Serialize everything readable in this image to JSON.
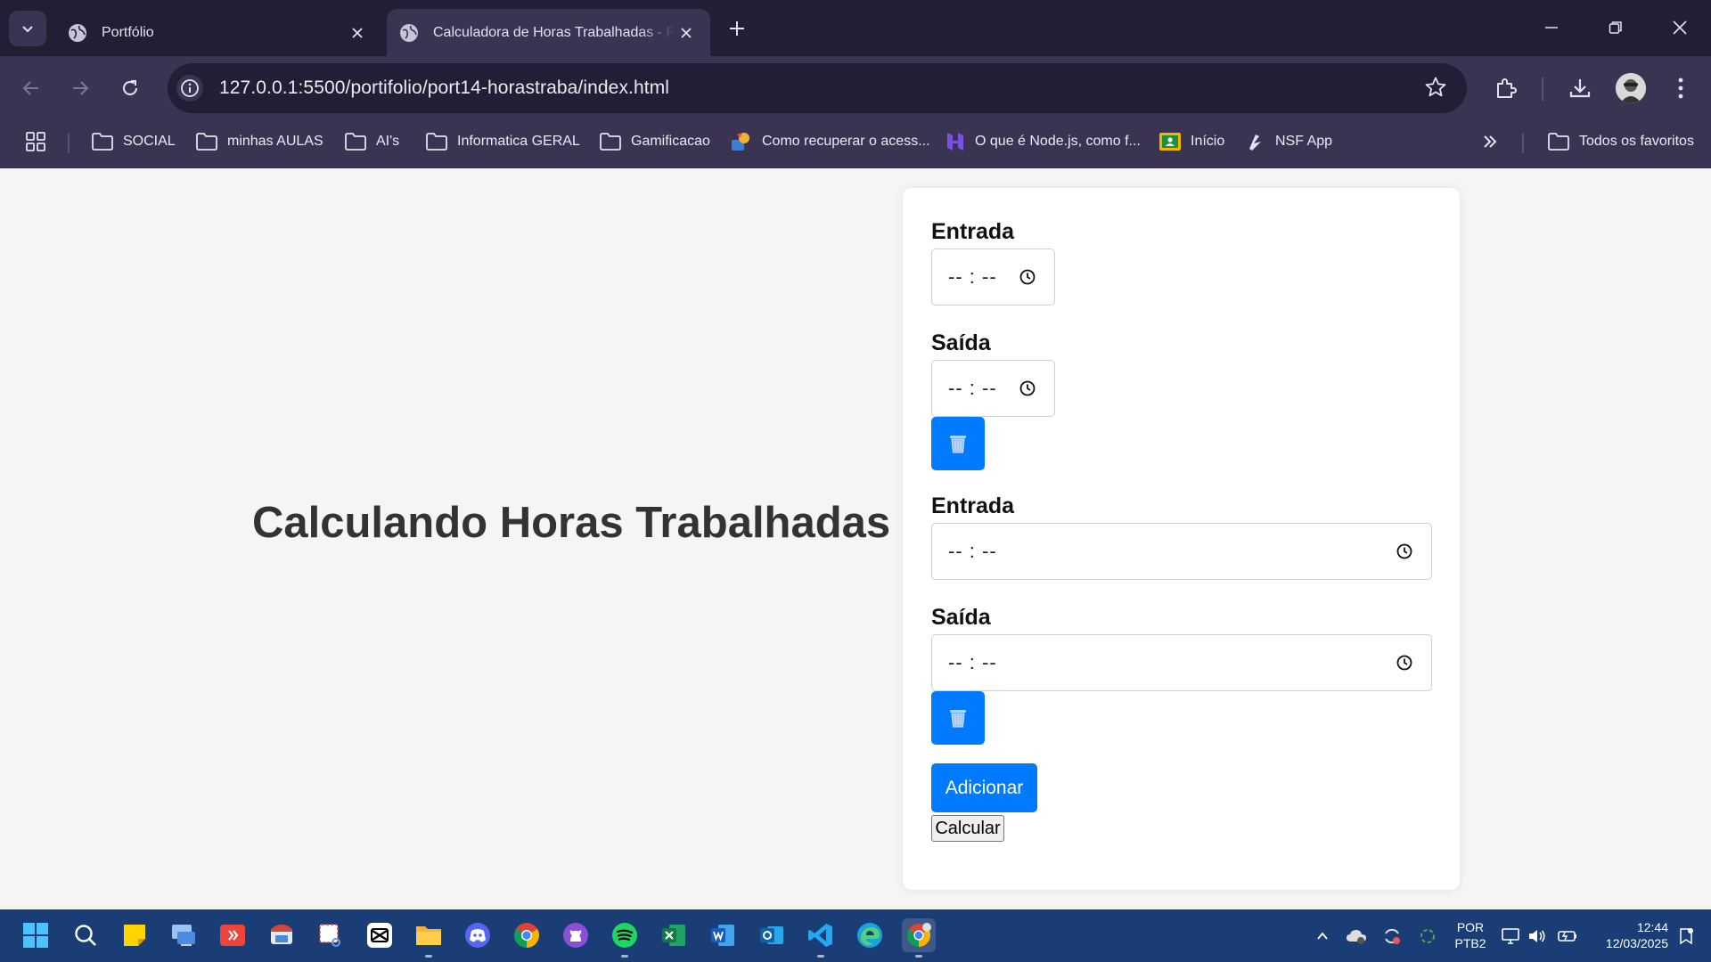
{
  "browser": {
    "tabs": [
      {
        "title": "Portfólio",
        "active": false
      },
      {
        "title": "Calculadora de Horas Trabalhadas - Pr",
        "active": true
      }
    ],
    "url": "127.0.0.1:5500/portifolio/port14-horastraba/index.html",
    "bookmarks": [
      {
        "label": "SOCIAL",
        "icon": "folder-icon"
      },
      {
        "label": "minhas AULAS",
        "icon": "folder-icon"
      },
      {
        "label": "AI's",
        "icon": "folder-icon"
      },
      {
        "label": "Informatica GERAL",
        "icon": "folder-icon"
      },
      {
        "label": "Gamificacao",
        "icon": "folder-icon"
      },
      {
        "label": "Como recuperar o acess...",
        "icon": "favicon-icon"
      },
      {
        "label": "O que é Node.js, como f...",
        "icon": "favicon-icon"
      },
      {
        "label": "Início",
        "icon": "classroom-icon"
      },
      {
        "label": "NSF App",
        "icon": "favicon-icon"
      }
    ],
    "all_bookmarks": "Todos os favoritos"
  },
  "page": {
    "title": "Calculando Horas Trabalhadas",
    "entries": [
      {
        "entrada_label": "Entrada",
        "entrada_value": "-- : --",
        "saida_label": "Saída",
        "saida_value": "-- : --"
      },
      {
        "entrada_label": "Entrada",
        "entrada_value": "-- : --",
        "saida_label": "Saída",
        "saida_value": "-- : --"
      }
    ],
    "add_button": "Adicionar",
    "calc_button": "Calcular"
  },
  "colors": {
    "primary": "#007bff",
    "tabstrip": "#231e35",
    "toolbar": "#3a3452",
    "taskbar": "#1a3d75"
  },
  "taskbar": {
    "language": "POR",
    "layout": "PTB2",
    "time": "12:44",
    "date": "12/03/2025"
  }
}
